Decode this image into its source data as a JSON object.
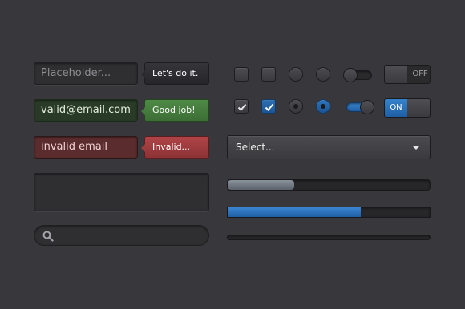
{
  "inputs": {
    "placeholder": "Placeholder...",
    "valid_value": "valid@email.com",
    "invalid_value": "invalid email"
  },
  "tooltips": {
    "default": "Let's do it.",
    "success": "Good job!",
    "error": "Invalid..."
  },
  "switches": {
    "off_label": "OFF",
    "on_label": "ON"
  },
  "select": {
    "selected": "Select..."
  },
  "progress": {
    "bar1": 0.33,
    "bar2": 0.66,
    "bar3": 0
  },
  "colors": {
    "accent_blue": "#2a6db5",
    "success_green": "#457c3d",
    "error_red": "#9c3b3e",
    "background": "#38383c"
  },
  "icons": {
    "search": "search-icon",
    "check": "check-icon",
    "dropdown": "chevron-down-icon"
  }
}
